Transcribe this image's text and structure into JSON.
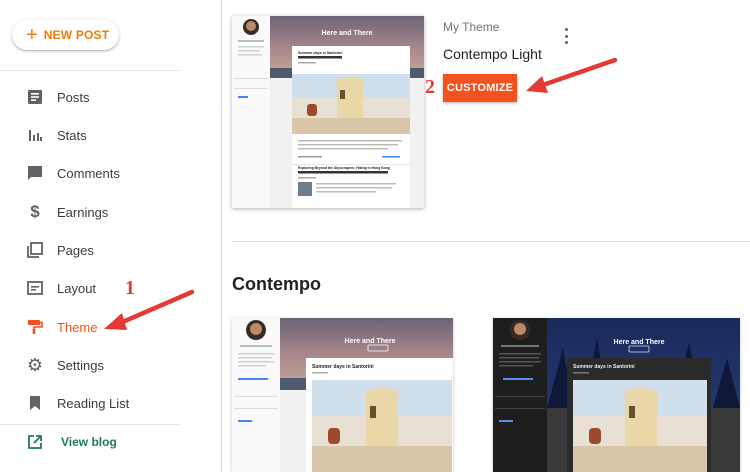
{
  "sidebar": {
    "new_post_label": "NEW POST",
    "items": [
      {
        "label": "Posts",
        "icon": "posts-icon"
      },
      {
        "label": "Stats",
        "icon": "stats-icon"
      },
      {
        "label": "Comments",
        "icon": "comments-icon"
      },
      {
        "label": "Earnings",
        "icon": "dollar-icon"
      },
      {
        "label": "Pages",
        "icon": "pages-icon"
      },
      {
        "label": "Layout",
        "icon": "layout-icon"
      },
      {
        "label": "Theme",
        "icon": "paint-roller-icon",
        "active": true
      },
      {
        "label": "Settings",
        "icon": "gear-icon"
      },
      {
        "label": "Reading List",
        "icon": "bookmark-icon"
      }
    ],
    "view_blog_label": "View blog"
  },
  "current_theme": {
    "heading": "My Theme",
    "name": "Contempo Light",
    "customize_label": "CUSTOMIZE",
    "preview": {
      "blog_title": "Here and There",
      "post1_title": "Summer days in Santorini",
      "post2_title": "Exploring Beyond the Skyscrapers: Hiking in Hong Kong"
    }
  },
  "section": {
    "title": "Contempo",
    "thumbs": [
      {
        "variant": "light",
        "blog_title": "Here and There",
        "post_title": "Summer days in Santorini"
      },
      {
        "variant": "dark",
        "blog_title": "Here and There",
        "post_title": "Summer days in Santorini"
      }
    ]
  },
  "annotations": {
    "step1": "1",
    "step2": "2"
  },
  "colors": {
    "accent_orange": "#f4511e",
    "new_post_orange": "#f57c00",
    "annotation_red": "#e53935",
    "view_blog_green": "#1e7a5c"
  }
}
